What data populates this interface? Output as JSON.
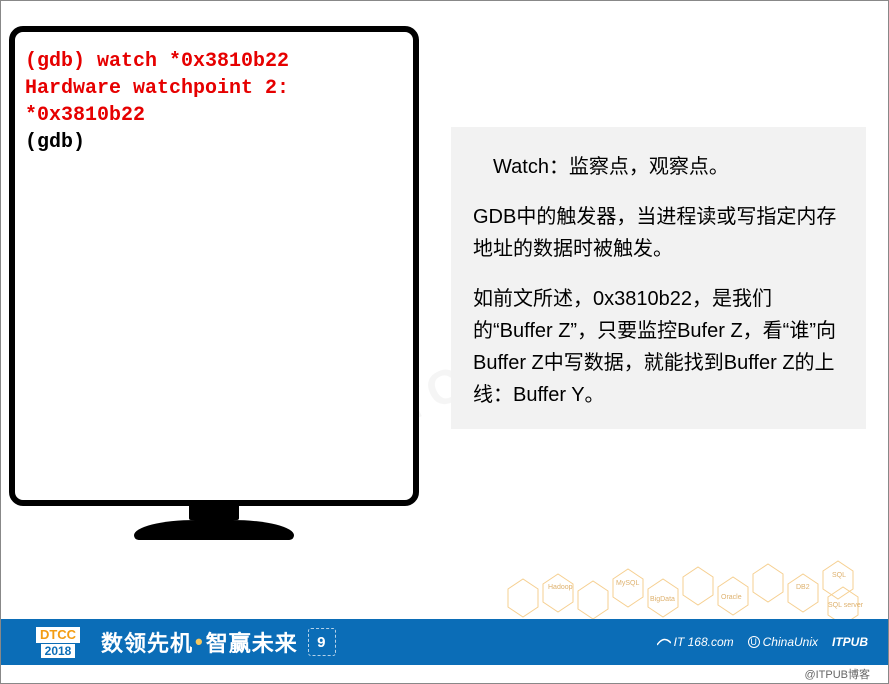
{
  "terminal": {
    "line1": "(gdb) watch *0x3810b22",
    "line2": "Hardware watchpoint 2:",
    "line3": "*0x3810b22",
    "line4": "(gdb)"
  },
  "description": {
    "p1": "Watch：监察点，观察点。",
    "p2": "GDB中的触发器，当进程读或写指定内存地址的数据时被触发。",
    "p3": "如前文所述，0x3810b22，是我们的“Buffer Z”，只要监控Bufer Z，看“谁”向Buffer Z中写数据，就能找到Buffer Z的上线：Buffer Y。"
  },
  "watermark": "DTCC2018",
  "hex_labels": [
    "Hadoop",
    "MySQL",
    "BigData",
    "Oracle",
    "DB2",
    "SQL",
    "SQL server"
  ],
  "footer": {
    "badge_top": "DTCC",
    "badge_bottom": "2018",
    "slogan_a": "数领先机",
    "slogan_b": "智赢未来",
    "nine": "9",
    "sponsor1": "IT 168.com",
    "sponsor2": "ChinaUnix",
    "sponsor3": "ITPUB"
  },
  "attribution": "@ITPUB博客"
}
